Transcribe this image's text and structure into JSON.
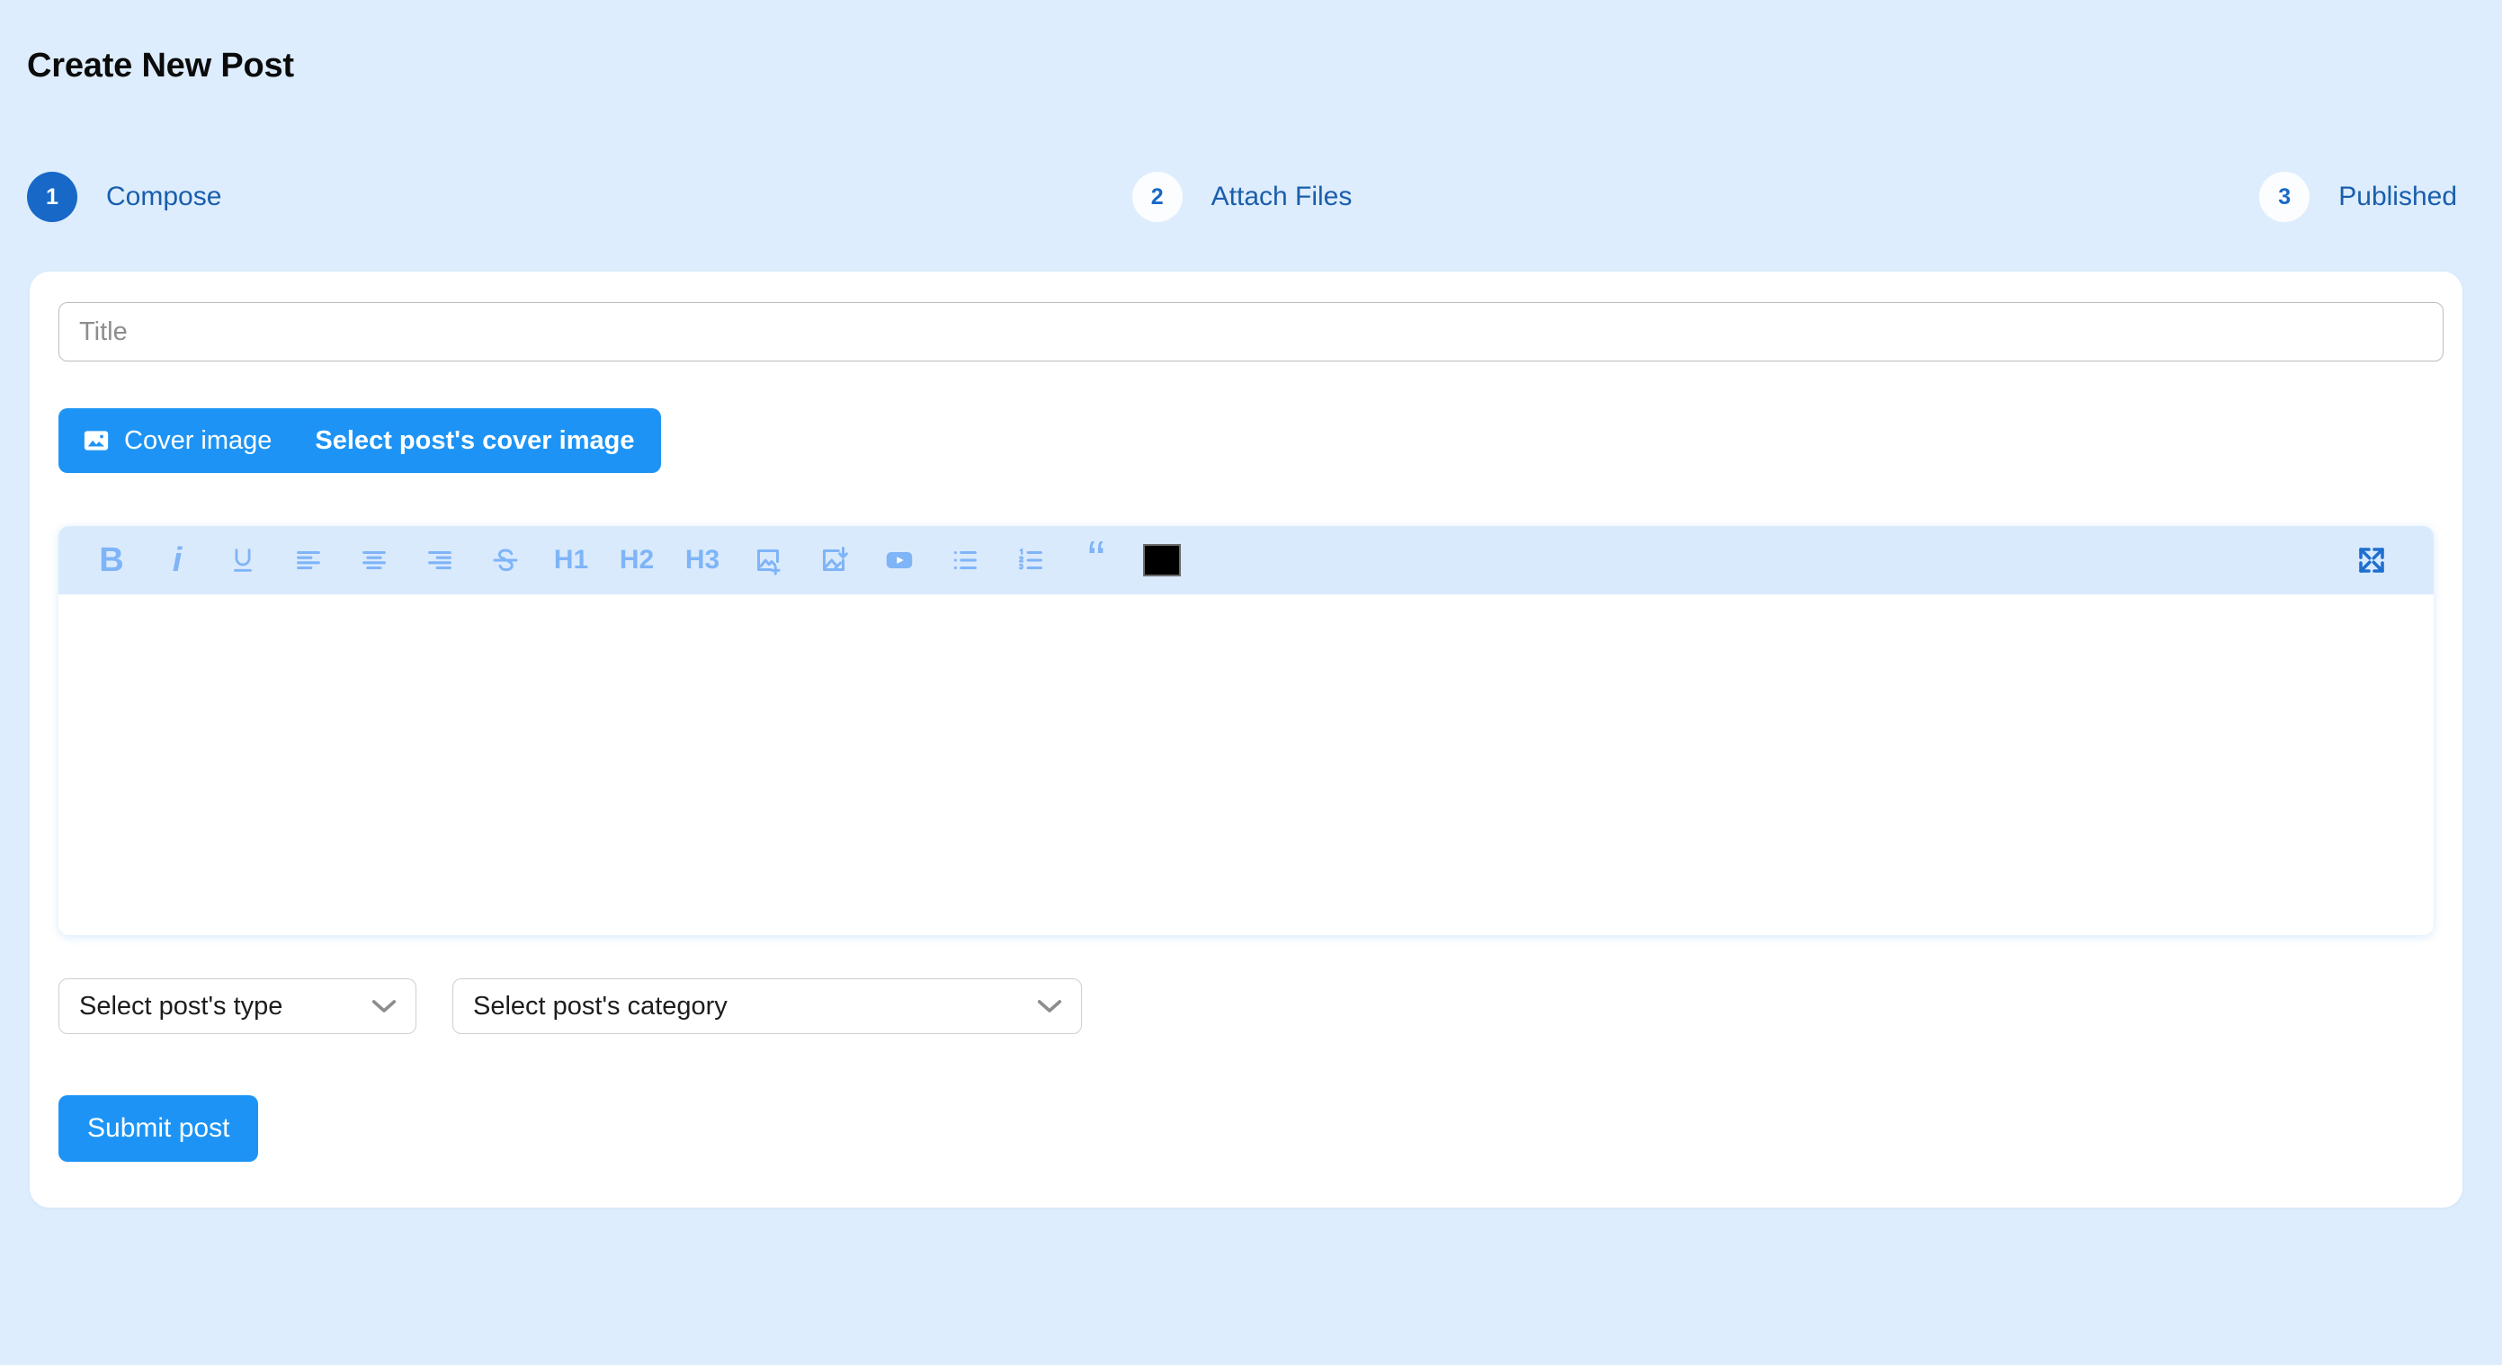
{
  "page": {
    "title": "Create New Post",
    "background_color": "#ddedfd"
  },
  "stepper": {
    "steps": [
      {
        "number": "1",
        "label": "Compose",
        "state": "active"
      },
      {
        "number": "2",
        "label": "Attach Files",
        "state": "inactive"
      },
      {
        "number": "3",
        "label": "Published",
        "state": "inactive"
      }
    ],
    "active_color": "#1868c8",
    "inactive_bg": "#fbfdff",
    "label_color": "#1a5eac"
  },
  "form": {
    "title_field": {
      "placeholder": "Title",
      "value": ""
    },
    "cover_image": {
      "icon": "image-icon",
      "label": "Cover image",
      "value": "Select post's cover image",
      "accent_color": "#1d94f5"
    },
    "post_type_select": {
      "value": "Select post's type",
      "caret": "chevron-down-icon"
    },
    "post_category_select": {
      "value": "Select post's category",
      "caret": "chevron-down-icon"
    },
    "submit_button": {
      "label": "Submit post",
      "color": "#1d94f5"
    }
  },
  "editor": {
    "toolbar_bg": "#daeafd",
    "icon_color": "#7fb4f7",
    "content": "",
    "color_swatch_value": "#000000",
    "toolbar": [
      {
        "name": "bold-icon",
        "glyph": "B",
        "kind": "glyph-bold"
      },
      {
        "name": "italic-icon",
        "glyph": "i",
        "kind": "glyph-italic"
      },
      {
        "name": "underline-icon",
        "glyph": "U",
        "kind": "svg-underline"
      },
      {
        "name": "align-left-icon",
        "glyph": "",
        "kind": "svg-align-left"
      },
      {
        "name": "align-center-icon",
        "glyph": "",
        "kind": "svg-align-center"
      },
      {
        "name": "align-right-icon",
        "glyph": "",
        "kind": "svg-align-right"
      },
      {
        "name": "strikethrough-icon",
        "glyph": "S",
        "kind": "svg-strike"
      },
      {
        "name": "heading-1-icon",
        "glyph": "H1",
        "kind": "glyph-heading"
      },
      {
        "name": "heading-2-icon",
        "glyph": "H2",
        "kind": "glyph-heading"
      },
      {
        "name": "heading-3-icon",
        "glyph": "H3",
        "kind": "glyph-heading"
      },
      {
        "name": "insert-image-icon",
        "glyph": "",
        "kind": "svg-image-add"
      },
      {
        "name": "upload-image-icon",
        "glyph": "",
        "kind": "svg-image-download"
      },
      {
        "name": "insert-video-icon",
        "glyph": "",
        "kind": "svg-video"
      },
      {
        "name": "bullet-list-icon",
        "glyph": "",
        "kind": "svg-bullet-list"
      },
      {
        "name": "numbered-list-icon",
        "glyph": "",
        "kind": "svg-numbered-list"
      },
      {
        "name": "blockquote-icon",
        "glyph": "“",
        "kind": "glyph-quote"
      },
      {
        "name": "text-color-swatch",
        "glyph": "",
        "kind": "color-swatch"
      },
      {
        "name": "fullscreen-icon",
        "glyph": "",
        "kind": "svg-fullscreen"
      }
    ]
  }
}
